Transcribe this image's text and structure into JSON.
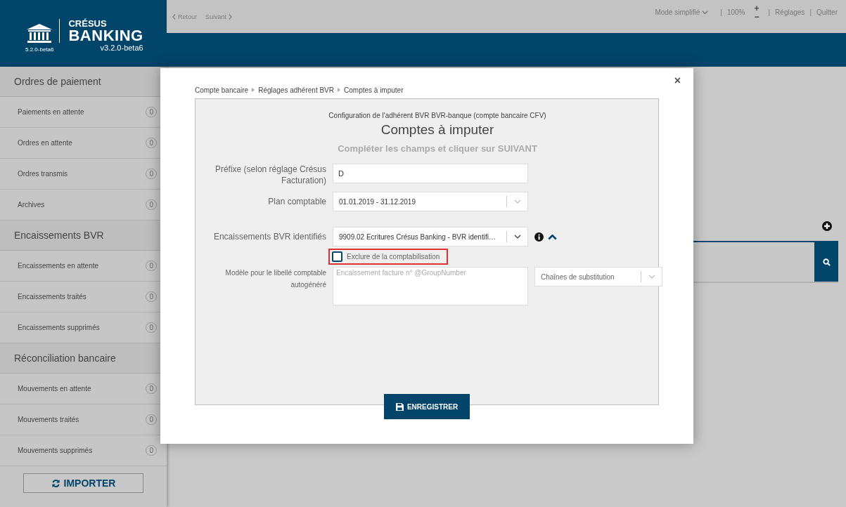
{
  "logo": {
    "brand_top": "CRÉSUS",
    "brand_main": "BANKING",
    "build": "5.2.0-beta6",
    "version": "v3.2.0-beta6"
  },
  "top_bar": {
    "nav": [
      {
        "kind": "back",
        "label": "Retour",
        "disabled": true
      },
      {
        "kind": "forward",
        "label": "Suivant",
        "disabled": true
      }
    ],
    "right": [
      {
        "kind": "dropdown",
        "text": "Mode simplifié"
      },
      {
        "kind": "separator",
        "text": "|"
      },
      {
        "kind": "text",
        "text": "100%"
      },
      {
        "kind": "zoom",
        "plus": "+",
        "minus": "−"
      },
      {
        "kind": "separator",
        "text": "|"
      },
      {
        "kind": "link",
        "text": "Réglages"
      },
      {
        "kind": "separator",
        "text": "|"
      },
      {
        "kind": "link",
        "text": "Quitter"
      }
    ]
  },
  "sidebar": {
    "sections": [
      {
        "title": "Ordres de paiement",
        "items": [
          {
            "label": "Paiements en attente",
            "count": "0"
          },
          {
            "label": "Ordres en attente",
            "count": "0"
          },
          {
            "label": "Ordres transmis",
            "count": "0"
          },
          {
            "label": "Archives",
            "count": "0"
          }
        ]
      },
      {
        "title": "Encaissements BVR",
        "items": [
          {
            "label": "Encaissements en attente",
            "count": "0"
          },
          {
            "label": "Encaissements traités",
            "count": "0"
          },
          {
            "label": "Encaissements supprimés",
            "count": "0"
          }
        ]
      },
      {
        "title": "Réconciliation bancaire",
        "items": [
          {
            "label": "Mouvements en attente",
            "count": "0"
          },
          {
            "label": "Mouvements traités",
            "count": "0"
          },
          {
            "label": "Mouvements supprimés",
            "count": "0"
          }
        ]
      }
    ],
    "import_button": "IMPORTER"
  },
  "dialog": {
    "breadcrumb": [
      "Compte bancaire",
      "Réglages adhérent BVR",
      "Comptes à imputer"
    ],
    "subtitle": "Configuration de l'adhérent BVR BVR-banque (compte bancaire CFV)",
    "title": "Comptes à imputer",
    "hint": "Compléter les champs et cliquer sur SUIVANT",
    "prefix": {
      "label": "Préfixe (selon réglage Crésus Facturation)",
      "value": "D"
    },
    "plan": {
      "label": "Plan comptable",
      "value": "01.01.2019 - 31.12.2019"
    },
    "bvr": {
      "label": "Encaissements BVR identifiés",
      "value": "9909.02 Ecritures Crésus Banking - BVR identifi…",
      "expanded": true
    },
    "exclude": {
      "label": "Exclure de la comptabilisation",
      "checked": false,
      "highlighted": true
    },
    "model": {
      "label": "Modèle pour le libellé comptable autogénéré",
      "placeholder": "Encaissement facture n° @GroupNumber",
      "substitution": "Chaînes de substitution"
    },
    "save_button": "ENREGISTRER",
    "close": "×"
  }
}
